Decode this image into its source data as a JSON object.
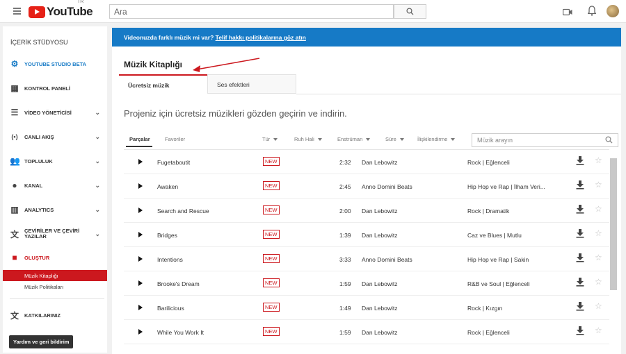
{
  "header": {
    "logo_text": "YouTube",
    "logo_region": "TR",
    "search_placeholder": "Ara"
  },
  "sidebar": {
    "title": "İÇERİK STÜDYOSU",
    "items": [
      {
        "label": "YOUTUBE STUDIO BETA",
        "icon": "gear-icon"
      },
      {
        "label": "KONTROL PANELİ",
        "icon": "dashboard-icon"
      },
      {
        "label": "VİDEO YÖNETİCİSİ",
        "icon": "video-manager-icon"
      },
      {
        "label": "CANLI AKIŞ",
        "icon": "live-icon"
      },
      {
        "label": "TOPLULUK",
        "icon": "people-icon"
      },
      {
        "label": "KANAL",
        "icon": "channel-icon"
      },
      {
        "label": "ANALYTICS",
        "icon": "analytics-icon"
      },
      {
        "label": "ÇEVİRİLER VE ÇEVİRİ YAZILAR",
        "icon": "translate-icon"
      },
      {
        "label": "OLUŞTUR",
        "icon": "create-icon"
      }
    ],
    "sub_items": [
      "Müzik Kitaplığı",
      "Müzik Politikaları"
    ],
    "contributions": "KATKILARINIZ",
    "help_button": "Yardım ve geri bildirim"
  },
  "banner": {
    "text": "Videonuzda farklı müzik mi var? ",
    "link": "Telif hakkı politikalarına göz atın"
  },
  "page_title": "Müzik Kitaplığı",
  "tabs": [
    "Ücretsiz müzik",
    "Ses efektleri"
  ],
  "intro": "Projeniz için ücretsiz müzikleri gözden geçirin ve indirin.",
  "filters": {
    "tabs": [
      "Parçalar",
      "Favoriler"
    ],
    "dropdowns": [
      "Tür",
      "Ruh Hali",
      "Enstrüman",
      "Süre",
      "İlişkilendirme"
    ],
    "search_placeholder": "Müzik arayın"
  },
  "tracks": [
    {
      "title": "Fugetaboutit",
      "badge": "NEW",
      "duration": "2:32",
      "artist": "Dan Lebowitz",
      "genre": "Rock | Eğlenceli"
    },
    {
      "title": "Awaken",
      "badge": "NEW",
      "duration": "2:45",
      "artist": "Anno Domini Beats",
      "genre": "Hip Hop ve Rap | İlham Veri..."
    },
    {
      "title": "Search and Rescue",
      "badge": "NEW",
      "duration": "2:00",
      "artist": "Dan Lebowitz",
      "genre": "Rock | Dramatik"
    },
    {
      "title": "Bridges",
      "badge": "NEW",
      "duration": "1:39",
      "artist": "Dan Lebowitz",
      "genre": "Caz ve Blues | Mutlu"
    },
    {
      "title": "Intentions",
      "badge": "NEW",
      "duration": "3:33",
      "artist": "Anno Domini Beats",
      "genre": "Hip Hop ve Rap | Sakin"
    },
    {
      "title": "Brooke's Dream",
      "badge": "NEW",
      "duration": "1:59",
      "artist": "Dan Lebowitz",
      "genre": "R&B ve Soul | Eğlenceli"
    },
    {
      "title": "Barilicious",
      "badge": "NEW",
      "duration": "1:49",
      "artist": "Dan Lebowitz",
      "genre": "Rock | Kızgın"
    },
    {
      "title": "While You Work It",
      "badge": "NEW",
      "duration": "1:59",
      "artist": "Dan Lebowitz",
      "genre": "Rock | Eğlenceli"
    }
  ],
  "colors": {
    "accent": "#167ac6",
    "brand": "#cc181e"
  }
}
